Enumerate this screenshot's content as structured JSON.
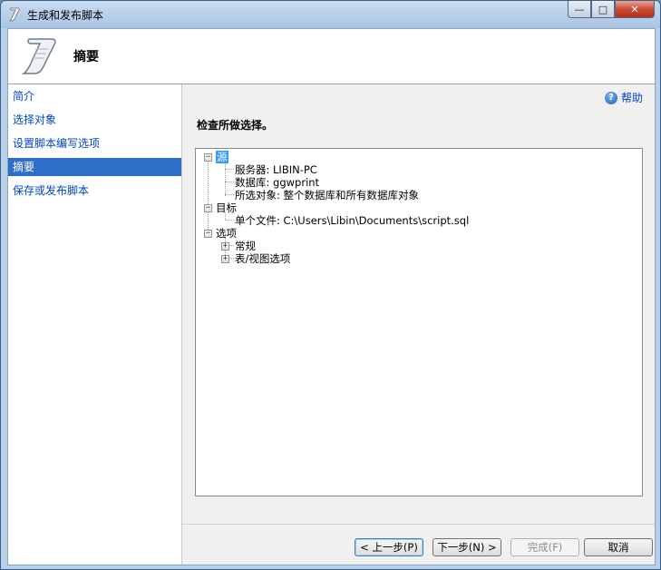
{
  "window": {
    "title": "生成和发布脚本",
    "minimize": "—",
    "maximize": "□",
    "close": "✕"
  },
  "header": {
    "title": "摘要",
    "icon": "scroll-icon"
  },
  "sidebar": {
    "items": [
      {
        "label": "简介",
        "active": false
      },
      {
        "label": "选择对象",
        "active": false
      },
      {
        "label": "设置脚本编写选项",
        "active": false
      },
      {
        "label": "摘要",
        "active": true
      },
      {
        "label": "保存或发布脚本",
        "active": false
      }
    ]
  },
  "help": {
    "label": "帮助",
    "icon": "help-icon"
  },
  "main": {
    "instruction": "检查所做选择。",
    "tree": {
      "source": {
        "label": "源",
        "server": "服务器: LIBIN-PC",
        "database": "数据库: ggwprint",
        "selected": "所选对象: 整个数据库和所有数据库对象"
      },
      "target": {
        "label": "目标",
        "file": "单个文件: C:\\Users\\Libin\\Documents\\script.sql"
      },
      "options": {
        "label": "选项",
        "general": "常规",
        "table_view": "表/视图选项"
      }
    }
  },
  "footer": {
    "prev": "< 上一步(P)",
    "next": "下一步(N) >",
    "finish": "完成(F)",
    "cancel": "取消"
  }
}
